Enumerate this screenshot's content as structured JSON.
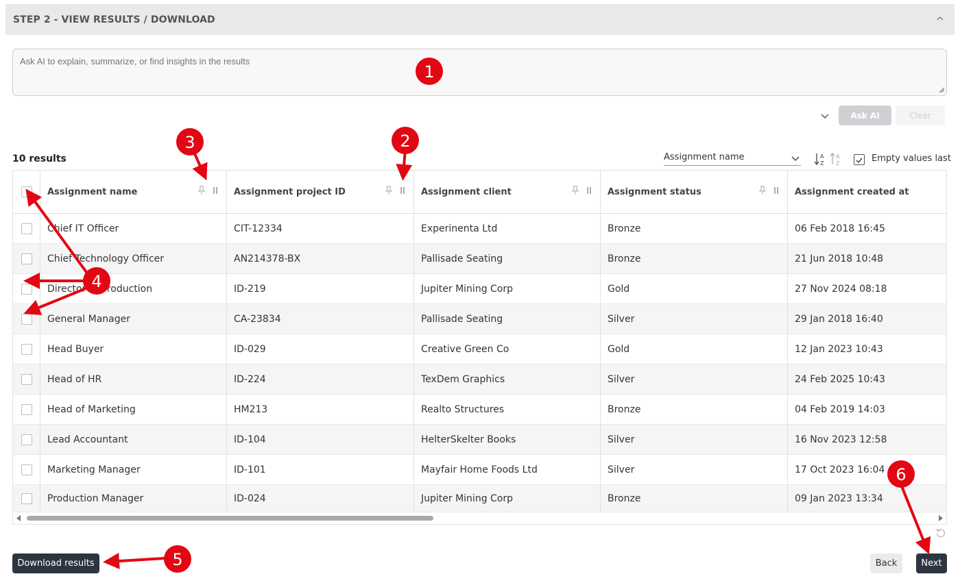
{
  "step": {
    "title": "STEP 2 - VIEW RESULTS / DOWNLOAD"
  },
  "ai": {
    "placeholder": "Ask AI to explain, summarize, or find insights in the results",
    "ask_label": "Ask AI",
    "clear_label": "Clear"
  },
  "results": {
    "count_label": "10 results"
  },
  "sort": {
    "field": "Assignment name",
    "empty_values_label": "Empty values last"
  },
  "columns": [
    "Assignment name",
    "Assignment project ID",
    "Assignment client",
    "Assignment status",
    "Assignment created at"
  ],
  "rows": [
    [
      "Chief IT Officer",
      "CIT-12334",
      "Experinenta Ltd",
      "Bronze",
      "06 Feb 2018 16:45"
    ],
    [
      "Chief Technology Officer",
      "AN214378-BX",
      "Pallisade Seating",
      "Bronze",
      "21 Jun 2018 10:48"
    ],
    [
      "Director of Production",
      "ID-219",
      "Jupiter Mining Corp",
      "Gold",
      "27 Nov 2024 08:18"
    ],
    [
      "General Manager",
      "CA-23834",
      "Pallisade Seating",
      "Silver",
      "29 Jan 2018 16:40"
    ],
    [
      "Head Buyer",
      "ID-029",
      "Creative Green Co",
      "Gold",
      "12 Jan 2023 10:43"
    ],
    [
      "Head of HR",
      "ID-224",
      "TexDem Graphics",
      "Silver",
      "24 Feb 2025 10:43"
    ],
    [
      "Head of Marketing",
      "HM213",
      "Realto Structures",
      "Bronze",
      "04 Feb 2019 14:03"
    ],
    [
      "Lead Accountant",
      "ID-104",
      "HelterSkelter Books",
      "Silver",
      "16 Nov 2023 12:58"
    ],
    [
      "Marketing Manager",
      "ID-101",
      "Mayfair Home Foods Ltd",
      "Silver",
      "17 Oct 2023 16:04"
    ],
    [
      "Production Manager",
      "ID-024",
      "Jupiter Mining Corp",
      "Bronze",
      "09 Jan 2023 13:34"
    ]
  ],
  "footer": {
    "download_label": "Download results",
    "back_label": "Back",
    "next_label": "Next"
  },
  "annotations": [
    "1",
    "2",
    "3",
    "4",
    "5",
    "6"
  ],
  "colors": {
    "annotation_red": "#e30613",
    "button_dark": "#2c3540",
    "header_bg": "#e9e9ec"
  }
}
